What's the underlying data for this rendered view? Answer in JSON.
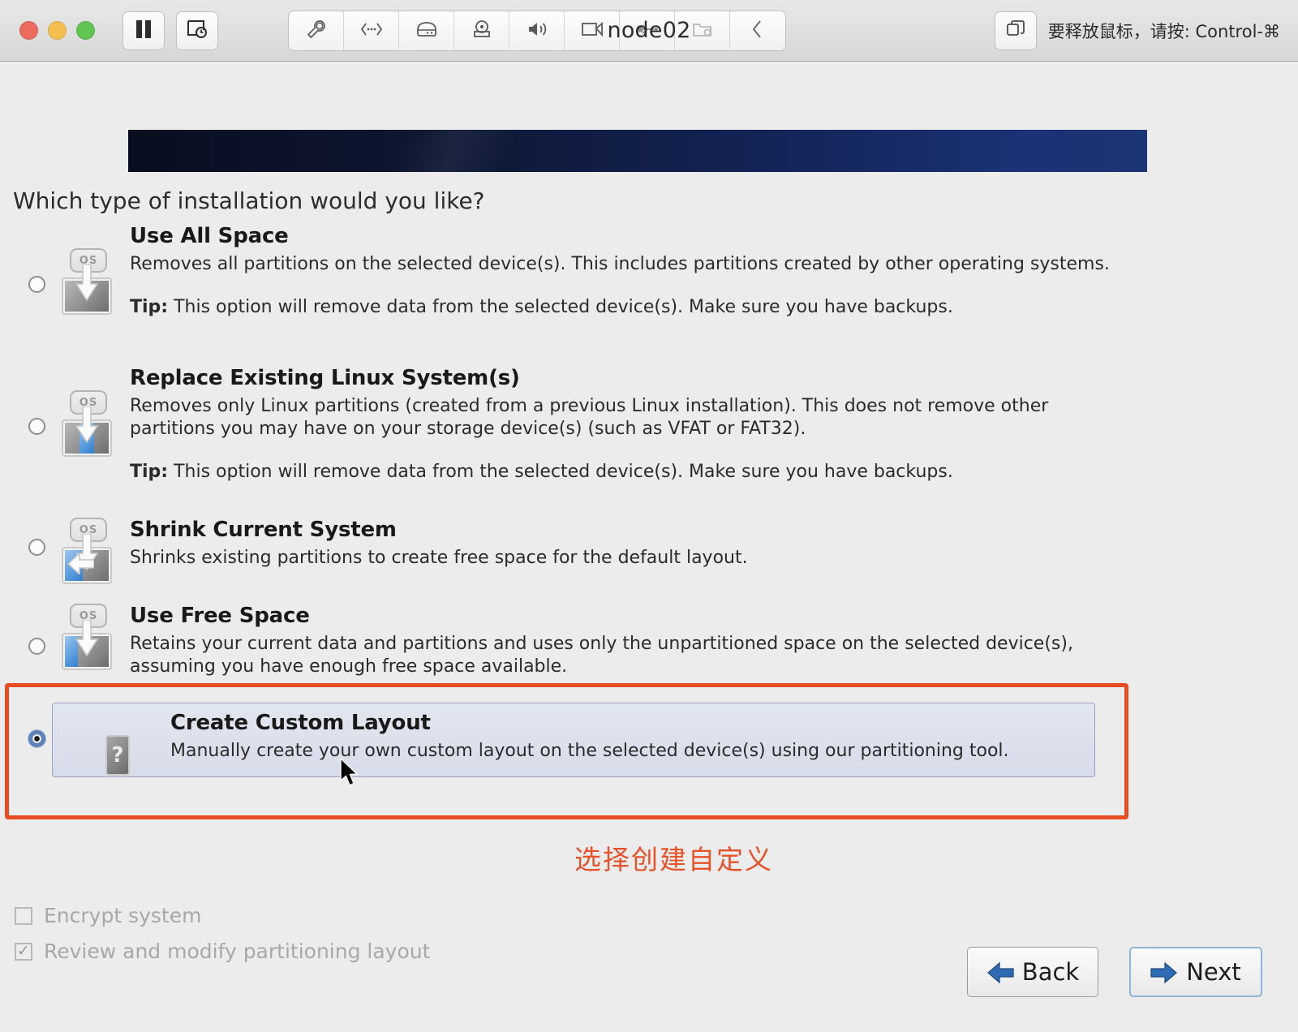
{
  "window": {
    "title": "node02",
    "release_hint": "要释放鼠标，请按: Control-⌘",
    "traffic_lights": [
      "close-button",
      "minimize-button",
      "zoom-button"
    ],
    "left_tools": [
      "pause-icon",
      "screenshot-timer-icon"
    ],
    "device_tools": [
      "wrench-icon",
      "network-icon",
      "hard-disk-icon",
      "cd-drive-icon",
      "sound-icon",
      "camera-icon",
      "usb-icon",
      "shared-folders-icon",
      "collapse-chevron-icon"
    ],
    "right_tool": "fullscreen-icon"
  },
  "page": {
    "question": "Which type of installation would you like?",
    "annotation": "选择创建自定义",
    "accent_color": "#e84c22",
    "selected_row_bg": "#dde1ec"
  },
  "options": [
    {
      "id": "use-all-space",
      "title": "Use All Space",
      "desc": "Removes all partitions on the selected device(s).  This includes partitions created by other operating systems.",
      "tip_label": "Tip:",
      "tip": "This option will remove data from the selected device(s).  Make sure you have backups.",
      "icon": "disk-full-icon",
      "selected": false
    },
    {
      "id": "replace-existing-linux",
      "title": "Replace Existing Linux System(s)",
      "desc": "Removes only Linux partitions (created from a previous Linux installation).  This does not remove other partitions you may have on your storage device(s) (such as VFAT or FAT32).",
      "tip_label": "Tip:",
      "tip": "This option will remove data from the selected device(s).  Make sure you have backups.",
      "icon": "disk-replace-linux-icon",
      "selected": false
    },
    {
      "id": "shrink-current-system",
      "title": "Shrink Current System",
      "desc": "Shrinks existing partitions to create free space for the default layout.",
      "tip_label": "",
      "tip": "",
      "icon": "disk-shrink-icon",
      "selected": false
    },
    {
      "id": "use-free-space",
      "title": "Use Free Space",
      "desc": "Retains your current data and partitions and uses only the unpartitioned space on the selected device(s), assuming you have enough free space available.",
      "tip_label": "",
      "tip": "",
      "icon": "disk-free-space-icon",
      "selected": false
    },
    {
      "id": "create-custom-layout",
      "title": "Create Custom Layout",
      "desc": "Manually create your own custom layout on the selected device(s) using our partitioning tool.",
      "tip_label": "",
      "tip": "",
      "icon": "disk-question-icon",
      "selected": true
    }
  ],
  "checkboxes": [
    {
      "id": "encrypt-system",
      "label": "Encrypt system",
      "checked": false,
      "mark": ""
    },
    {
      "id": "review-modify-partitioning",
      "label": "Review and modify partitioning layout",
      "checked": true,
      "mark": "✓"
    }
  ],
  "nav": {
    "back_label": "Back",
    "next_label": "Next"
  }
}
